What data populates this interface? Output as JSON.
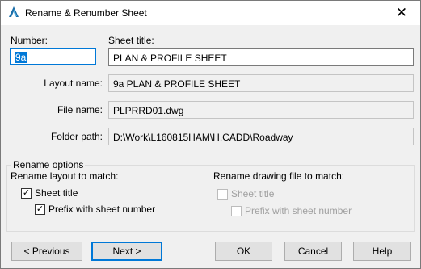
{
  "window": {
    "title": "Rename & Renumber Sheet",
    "close_glyph": "✕",
    "app_icon": "autocad-a-icon"
  },
  "fields": {
    "number_label": "Number:",
    "number_value": "9a",
    "sheet_title_label": "Sheet title:",
    "sheet_title_value": "PLAN & PROFILE SHEET",
    "layout_name_label": "Layout name:",
    "layout_name_value": "9a PLAN & PROFILE SHEET",
    "file_name_label": "File name:",
    "file_name_value": "PLPRRD01.dwg",
    "folder_path_label": "Folder path:",
    "folder_path_value": "D:\\Work\\L160815HAM\\H.CADD\\Roadway"
  },
  "rename_options": {
    "group_title": "Rename options",
    "layout_heading": "Rename layout to match:",
    "layout_sheet_title": {
      "label": "Sheet title",
      "checked": true,
      "enabled": true
    },
    "layout_prefix": {
      "label": "Prefix with sheet number",
      "checked": true,
      "enabled": true
    },
    "drawing_heading": "Rename drawing file to match:",
    "drawing_sheet_title": {
      "label": "Sheet title",
      "checked": false,
      "enabled": false
    },
    "drawing_prefix": {
      "label": "Prefix with sheet number",
      "checked": false,
      "enabled": false
    }
  },
  "buttons": {
    "previous": "< Previous",
    "next": "Next >",
    "ok": "OK",
    "cancel": "Cancel",
    "help": "Help"
  },
  "glyphs": {
    "check": "✓"
  },
  "colors": {
    "accent": "#0078d7",
    "dialog_bg": "#f0f0f0",
    "disabled_text": "#a0a0a0"
  }
}
